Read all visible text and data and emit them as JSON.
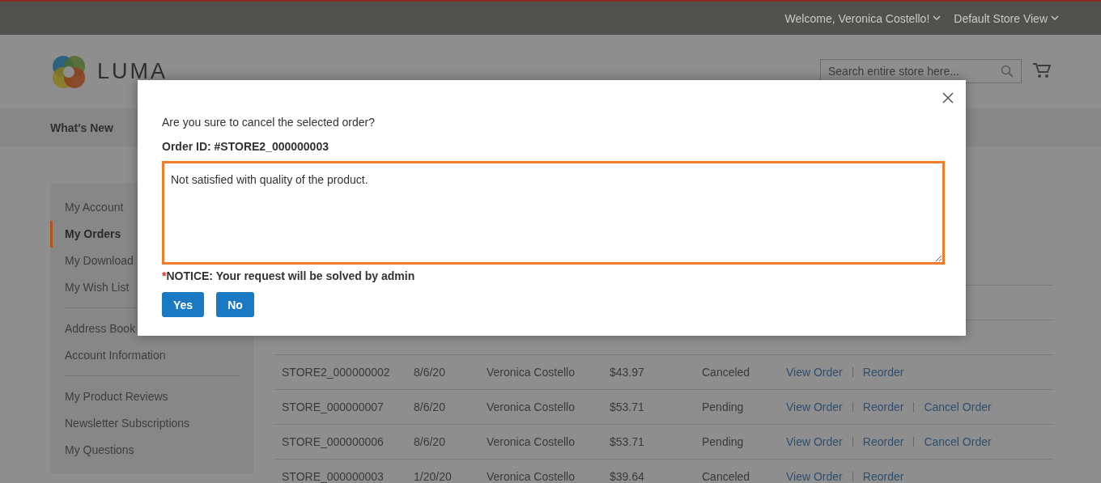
{
  "top_bar": {
    "welcome": "Welcome, Veronica Costello!",
    "store_switcher": "Default Store View"
  },
  "header": {
    "logo_text": "LUMA",
    "search": {
      "placeholder": "Search entire store here..."
    }
  },
  "menu": [
    {
      "label": "What's New"
    }
  ],
  "sidebar": {
    "groups": [
      [
        {
          "label": "My Account",
          "selected": false
        },
        {
          "label": "My Orders",
          "selected": true
        },
        {
          "label": "My Download",
          "selected": false
        },
        {
          "label": "My Wish List",
          "selected": false
        }
      ],
      [
        {
          "label": "Address Book",
          "selected": false
        },
        {
          "label": "Account Information",
          "selected": false
        }
      ],
      [
        {
          "label": "My Product Reviews",
          "selected": false
        },
        {
          "label": "Newsletter Subscriptions",
          "selected": false
        },
        {
          "label": "My Questions",
          "selected": false
        }
      ]
    ]
  },
  "orders": {
    "rows": [
      {
        "order": "STORE2_000000002",
        "date": "8/6/20",
        "ship_to": "Veronica Costello",
        "total": "$43.97",
        "status": "Canceled",
        "actions": [
          "View Order",
          "Reorder"
        ]
      },
      {
        "order": "STORE_000000007",
        "date": "8/6/20",
        "ship_to": "Veronica Costello",
        "total": "$53.71",
        "status": "Pending",
        "actions": [
          "View Order",
          "Reorder",
          "Cancel Order"
        ]
      },
      {
        "order": "STORE_000000006",
        "date": "8/6/20",
        "ship_to": "Veronica Costello",
        "total": "$53.71",
        "status": "Pending",
        "actions": [
          "View Order",
          "Reorder",
          "Cancel Order"
        ]
      },
      {
        "order": "STORE_000000003",
        "date": "1/20/20",
        "ship_to": "Veronica Costello",
        "total": "$39.64",
        "status": "Canceled",
        "actions": [
          "View Order",
          "Reorder"
        ]
      }
    ]
  },
  "dialog": {
    "question": "Are you sure to cancel the selected order?",
    "order_id": "Order ID: #STORE2_000000003",
    "reason": "Not satisfied with quality of the product.",
    "notice_mark": "*",
    "notice": "NOTICE: Your request will be solved by admin",
    "buttons": [
      "Yes",
      "No"
    ]
  }
}
